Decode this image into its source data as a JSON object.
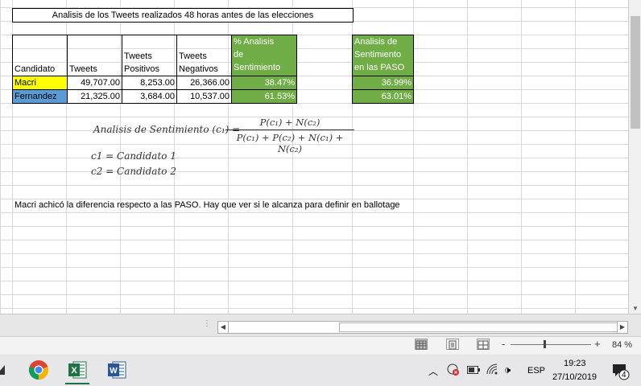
{
  "sheet": {
    "title": "Analisis de los Tweets realizados 48 horas antes de las elecciones",
    "table": {
      "headers": {
        "candidato": "Candidato",
        "tweets": "Tweets",
        "positivos_1": "Tweets",
        "positivos_2": "Positivos",
        "negativos_1": "Tweets",
        "negativos_2": "Negativos",
        "analisis_1": "% Analisis",
        "analisis_2": "de",
        "analisis_3": "Sentimiento",
        "paso_1": "Analisis de",
        "paso_2": "Sentimiento",
        "paso_3": "en las PASO"
      },
      "rows": [
        {
          "candidato": "Macri",
          "tweets": "49,707.00",
          "positivos": "8,253.00",
          "negativos": "26,366.00",
          "analisis": "38.47%",
          "paso": "36.99%"
        },
        {
          "candidato": "Fernandez",
          "tweets": "21,325.00",
          "positivos": "3,684.00",
          "negativos": "10,537.00",
          "analisis": "61.53%",
          "paso": "63.01%"
        }
      ]
    },
    "formula": {
      "lhs": "Analisis de Sentimiento (c₁) =",
      "numerator": "P(c₁) + N(c₂)",
      "denominator": "P(c₁) + P(c₂) + N(c₁) + N(c₂)",
      "c1": "c1 = Candidato 1",
      "c2": "c2 = Candidato 2"
    },
    "note": "Macri achicó la diferencia respecto a las PASO. Hay que ver si le alcanza para definir en ballotage"
  },
  "statusbar": {
    "zoom": "84 %",
    "zoom_minus": "-",
    "zoom_plus": "+"
  },
  "taskbar": {
    "lang": "ESP",
    "time": "19:23",
    "date": "27/10/2019",
    "notifications": "4"
  },
  "colors": {
    "green": "#70ad47",
    "yellow": "#ffff00",
    "blue": "#5b9bd5",
    "excel": "#1f7244",
    "word": "#2b5797"
  },
  "icons": [
    "chrome-icon",
    "excel-icon",
    "word-icon",
    "chevron-up-icon",
    "wifi-icon",
    "volume-icon",
    "battery-icon",
    "notification-icon"
  ]
}
